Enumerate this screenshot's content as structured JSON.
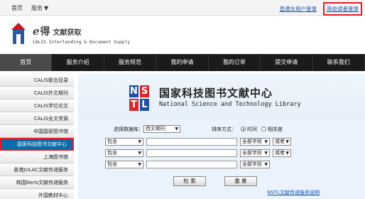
{
  "topbar": {
    "home_label": "首页",
    "service_label": "服务",
    "direct_login": "直通车用户登录",
    "school_login": "高校读者登录"
  },
  "logo": {
    "brand_latin": "e",
    "brand_cn": "得",
    "brand_sub": "文献获取",
    "english": "CALIS Interlending & Document Supply"
  },
  "nav": {
    "items": [
      "首页",
      "服务介绍",
      "服务规范",
      "我的申请",
      "我的订单",
      "提交申请",
      "联系我们"
    ]
  },
  "sidebar": {
    "items": [
      "CALIS联合目录",
      "CALIS外文期刊",
      "CALIS学位论文",
      "CALIS全文资源",
      "中国国家图书馆",
      "国家科技图书文献中心",
      "上海图书馆",
      "香港JULAC文献传递服务",
      "韩国Keris文献传递服务",
      "外国教材中心"
    ]
  },
  "banner": {
    "logo_letters": [
      "N",
      "S",
      "T",
      "L"
    ],
    "title_cn": "国家科技图书文献中心",
    "title_en": "National Science and Technology Library"
  },
  "search": {
    "db_label": "选择数据库：",
    "db_value": "西文期刊",
    "sort_label": "排序方式：",
    "sort_time": "时间",
    "sort_relevance": "相关度",
    "rows": [
      {
        "match": "包含",
        "field": "全部字段",
        "logic": "或者"
      },
      {
        "match": "包含",
        "field": "全部字段",
        "logic": "或者"
      },
      {
        "match": "包含",
        "field": "全部字段",
        "logic": ""
      }
    ],
    "search_button": "检 索",
    "reset_button": "重 置",
    "guide_link": "NSTL文献传递服务说明"
  },
  "colors": {
    "nav_bg": "#1b1b1b",
    "active_sidebar": "#0b6aa8",
    "highlight_red": "#e41e26",
    "link_blue": "#1a56b0"
  }
}
